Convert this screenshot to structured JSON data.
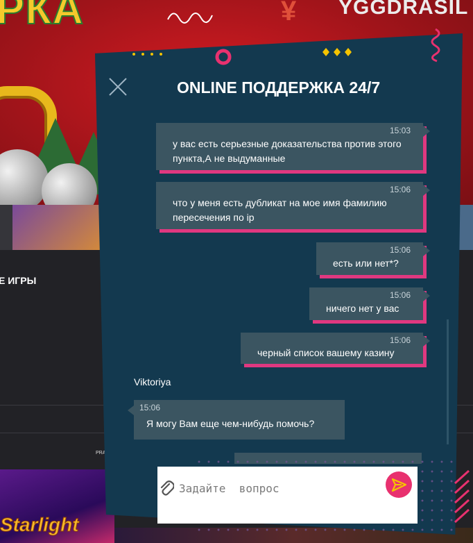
{
  "background": {
    "hero_text": "РКА",
    "provider_name": "YGGDRASIL",
    "section_title": "Е ИГРЫ",
    "provider_label": "PRAGMA",
    "game_title": "Starlight"
  },
  "chat": {
    "title": "ONLINE ПОДДЕРЖКА 24/7",
    "messages": [
      {
        "time": "15:03",
        "text": "у вас есть серьезные доказательства против этого пункта,А не выдуманные"
      },
      {
        "time": "15:06",
        "text": "что у меня есть дубликат на мое имя фамилию пересечения по ip"
      },
      {
        "time": "15:06",
        "text": "есть или нет*?"
      },
      {
        "time": "15:06",
        "text": "ничего нет у вас"
      },
      {
        "time": "15:06",
        "text": "черный список вашему казину"
      }
    ],
    "agent": {
      "name": "Viktoriya",
      "time": "15:06",
      "text": "Я могу Вам еще чем-нибудь помочь?"
    },
    "input_placeholder": "Задайте  вопрос"
  },
  "colors": {
    "panel": "#13394f",
    "bubble": "#3b5561",
    "accent": "#e03880",
    "decor_yellow": "#f5c400"
  },
  "icons": [
    "close-icon",
    "paperclip-icon",
    "send-icon"
  ]
}
